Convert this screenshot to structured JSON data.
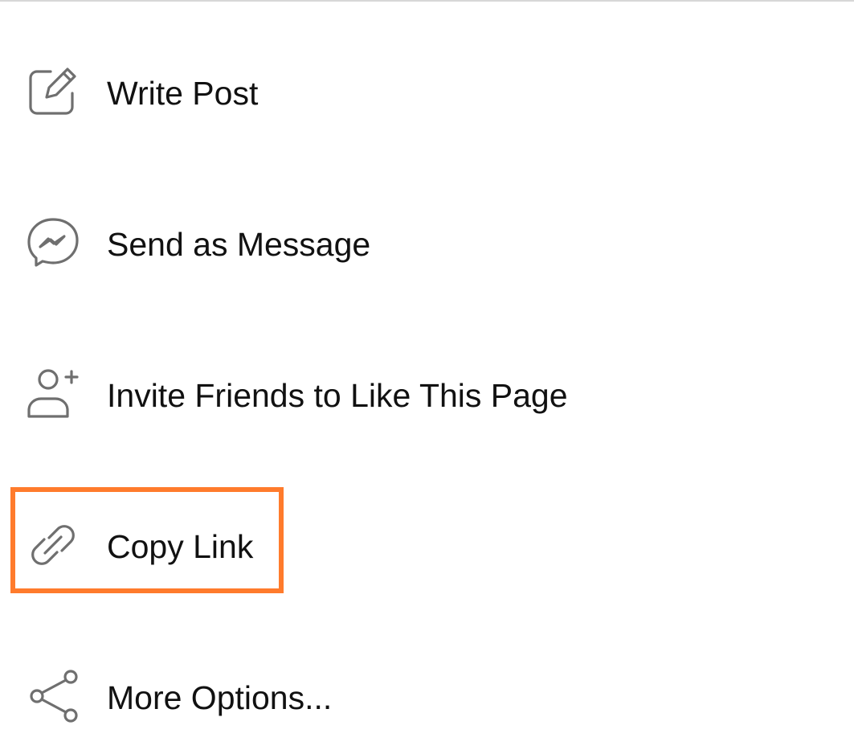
{
  "menu": {
    "items": [
      {
        "id": "write-post",
        "label": "Write Post",
        "icon": "compose-icon"
      },
      {
        "id": "send-as-message",
        "label": "Send as Message",
        "icon": "messenger-icon"
      },
      {
        "id": "invite-friends",
        "label": "Invite Friends to Like This Page",
        "icon": "add-friend-icon"
      },
      {
        "id": "copy-link",
        "label": "Copy Link",
        "icon": "link-icon",
        "highlighted": true
      },
      {
        "id": "more-options",
        "label": "More Options...",
        "icon": "share-icon"
      }
    ]
  },
  "colors": {
    "icon_stroke": "#6f6f6f",
    "text": "#111111",
    "highlight": "#ff7b2c",
    "divider": "#d7d7d7"
  }
}
